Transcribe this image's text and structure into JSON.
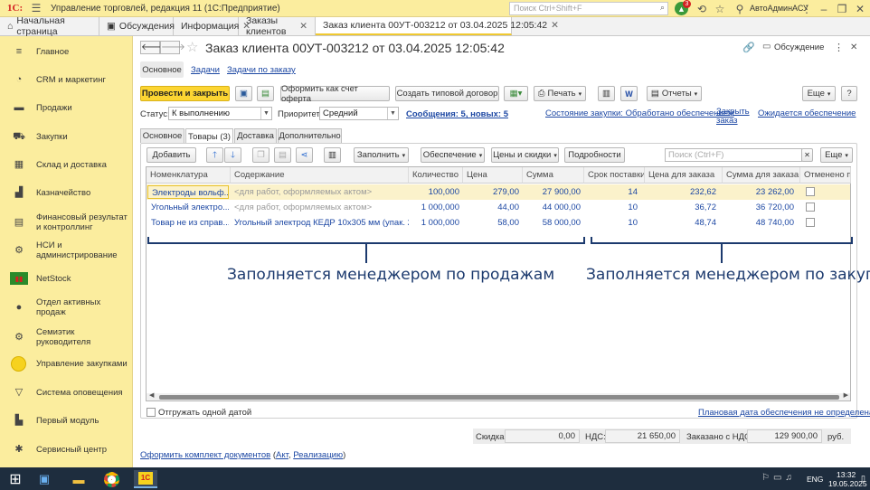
{
  "app": {
    "title": "Управление торговлей, редакция 11  (1С:Предприятие)",
    "search_placeholder": "Поиск Ctrl+Shift+F",
    "notifications_count": "3",
    "user": "АвтоАдминАСУ"
  },
  "window_tabs": [
    {
      "label": "Начальная страница"
    },
    {
      "label": "Обсуждения"
    },
    {
      "label": "Информация"
    },
    {
      "label": "Заказы клиентов"
    },
    {
      "label": "Заказ клиента 00УТ-003212 от 03.04.2025 12:05:42"
    }
  ],
  "sidebar": {
    "items": [
      {
        "label": "Главное",
        "icon": "menu-icon"
      },
      {
        "label": "CRM и маркетинг",
        "icon": "pie-chart-icon"
      },
      {
        "label": "Продажи",
        "icon": "wallet-icon"
      },
      {
        "label": "Закупки",
        "icon": "cart-icon"
      },
      {
        "label": "Склад и доставка",
        "icon": "warehouse-icon"
      },
      {
        "label": "Казначейство",
        "icon": "treasury-icon"
      },
      {
        "label": "Финансовый результат и контроллинг",
        "icon": "finance-icon"
      },
      {
        "label": "НСИ и администрирование",
        "icon": "gear-icon"
      },
      {
        "label": "NetStock",
        "icon": "netstock-icon"
      },
      {
        "label": "Отдел активных продаж",
        "icon": "person-icon"
      },
      {
        "label": "Семиэтик руководителя",
        "icon": "gear-icon"
      },
      {
        "label": "Управление закупками",
        "icon": "circle-icon"
      },
      {
        "label": "Система оповещения",
        "icon": "triangle-icon"
      },
      {
        "label": "Первый модуль",
        "icon": "module-icon"
      },
      {
        "label": "Сервисный центр",
        "icon": "service-icon"
      }
    ]
  },
  "form": {
    "title": "Заказ клиента 00УТ-003212 от 03.04.2025 12:05:42",
    "discussion_label": "Обсуждение",
    "nav": {
      "main": "Основное",
      "tasks": "Задачи",
      "tasks_by_order": "Задачи по заказу"
    },
    "toolbar": {
      "post_close": "Провести и закрыть",
      "invoice_offer": "Оформить как счет оферта",
      "create_contract": "Создать типовой договор",
      "print": "Печать",
      "reports": "Отчеты",
      "more": "Еще",
      "help": "?"
    },
    "status_label": "Статус:",
    "status_value": "К выполнению",
    "priority_label": "Приоритет:",
    "priority_value": "Средний",
    "messages_link": "Сообщения: 5, новых: 5",
    "purchase_state_link": "Состояние закупки: Обработано обеспечением",
    "close_order_link": "Закрыть заказ",
    "expected_supply_link": "Ожидается обеспечение",
    "tabs": [
      "Основное",
      "Товары (3)",
      "Доставка",
      "Дополнительно"
    ],
    "goods_toolbar": {
      "add": "Добавить",
      "fill": "Заполнить",
      "supply": "Обеспечение",
      "prices": "Цены и скидки",
      "details": "Подробности",
      "search_placeholder": "Поиск (Ctrl+F)",
      "more": "Еще"
    },
    "grid": {
      "columns": [
        "Номенклатура",
        "Содержание",
        "Количество",
        "Цена",
        "Сумма",
        "Срок поставки",
        "Цена для заказа",
        "Сумма для заказа",
        "Отменено по"
      ],
      "rows": [
        [
          "Электроды вольф...",
          "<для работ, оформляемых актом>",
          "100,000",
          "279,00",
          "27 900,00",
          "14",
          "232,62",
          "23 262,00",
          ""
        ],
        [
          "Угольный электро...",
          "<для работ, оформляемых актом>",
          "1 000,000",
          "44,00",
          "44 000,00",
          "10",
          "36,72",
          "36 720,00",
          ""
        ],
        [
          "Товар не из справ...",
          "Угольный электрод КЕДР 10x305 мм (упак. 2...",
          "1 000,000",
          "58,00",
          "58 000,00",
          "10",
          "48,74",
          "48 740,00",
          ""
        ]
      ]
    },
    "annotation_left": "Заполняется менеджером по продажам",
    "annotation_right": "Заполняется менеджером по закупкам",
    "ship_one_date": "Отгружать одной датой",
    "planned_date_link": "Плановая дата обеспечения не определена",
    "totals": {
      "discount_label": "Скидка:",
      "discount_value": "0,00",
      "vat_label": "НДС:",
      "vat_value": "21 650,00",
      "ordered_label": "Заказано с НДС:",
      "ordered_value": "129 900,00",
      "currency": "руб."
    },
    "docs_link": "Оформить комплект документов",
    "docs_paren_open": " (",
    "docs_act": "Акт",
    "docs_comma": ", ",
    "docs_realization": "Реализацию",
    "docs_paren_close": ")"
  },
  "taskbar": {
    "lang": "ENG",
    "time": "13:32",
    "date": "19.05.2025"
  }
}
